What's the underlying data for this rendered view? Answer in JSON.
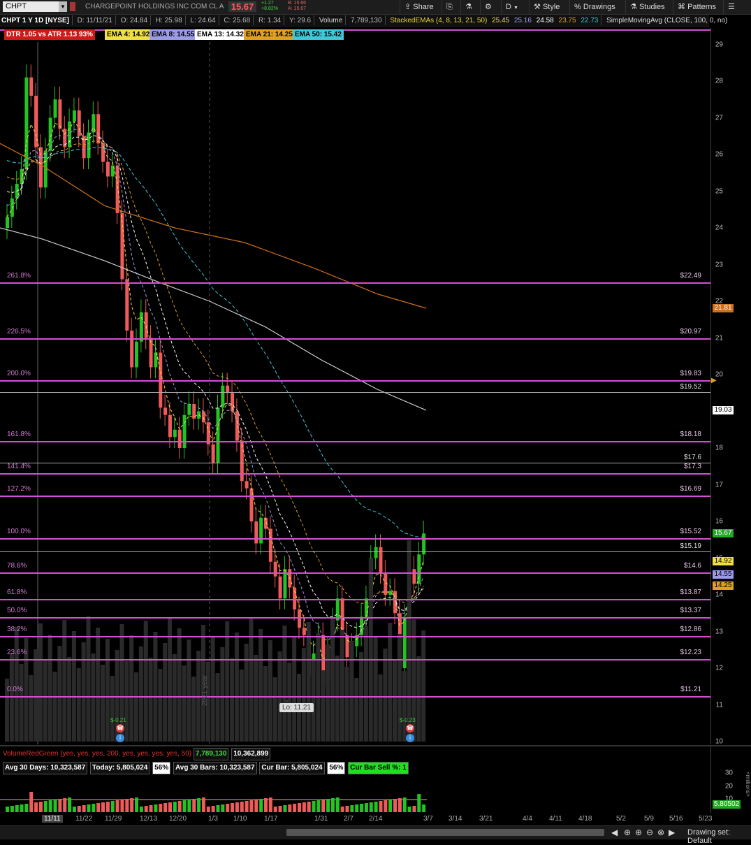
{
  "toolbar": {
    "symbol": "CHPT",
    "company": "CHARGEPOINT HOLDINGS INC COM CL A",
    "last": "15.67",
    "change": "+1.27",
    "change_pct": "+8.82%",
    "bid": "B: 15.66",
    "ask": "A: 15.67",
    "share": "Share",
    "timeframe": "D",
    "style": "Style",
    "drawings": "Drawings",
    "studies": "Studies",
    "patterns": "Patterns"
  },
  "header": {
    "title": "CHPT 1 Y 1D [NYSE]",
    "date": "D: 11/11/21",
    "open": "O: 24.84",
    "high": "H: 25.98",
    "low": "L: 24.64",
    "close": "C: 25.68",
    "range": "R: 1.34",
    "y": "Y: 29.6",
    "volume_label": "Volume",
    "volume": "7,789,130",
    "stacked_label": "StackedEMAs (4, 8, 13, 21, 50)",
    "stacked_values": [
      "25.45",
      "25.16",
      "24.58",
      "23.75",
      "22.73"
    ],
    "sma_label": "SimpleMovingAvg (CLOSE, 100, 0, no)"
  },
  "studies": {
    "dtr": "DTR 1.05 vs ATR 1.13  93%",
    "ema4": "EMA 4: 14.92",
    "ema8": "EMA 8: 14.55",
    "ema13": "EMA 13: 14.32",
    "ema21": "EMA 21: 14.25",
    "ema50": "EMA 50: 15.42"
  },
  "price_axis": {
    "ticks": [
      "29",
      "28",
      "27",
      "26",
      "25",
      "24",
      "23",
      "22",
      "21",
      "20",
      "19",
      "18",
      "17",
      "16",
      "15",
      "14",
      "13",
      "12",
      "11",
      "10"
    ],
    "tags": {
      "last": "15.67",
      "sma100": "19.03",
      "sma200": "21.81",
      "ema4": "14.92",
      "ema8": "14.55",
      "ema21": "14.25"
    }
  },
  "fib_levels": [
    {
      "pct": "261.8%",
      "price": "$22.49",
      "y": 22.49
    },
    {
      "pct": "226.5%",
      "price": "$20.97",
      "y": 20.97
    },
    {
      "pct": "200.0%",
      "price": "$19.83",
      "y": 19.83
    },
    {
      "pct": "161.8%",
      "price": "$18.18",
      "y": 18.18
    },
    {
      "pct": "141.4%",
      "price": "$17.3",
      "y": 17.3
    },
    {
      "pct": "127.2%",
      "price": "$16.69",
      "y": 16.69
    },
    {
      "pct": "100.0%",
      "price": "$15.52",
      "y": 15.52
    },
    {
      "pct": "78.6%",
      "price": "$14.6",
      "y": 14.6
    },
    {
      "pct": "61.8%",
      "price": "$13.87",
      "y": 13.87
    },
    {
      "pct": "50.0%",
      "price": "$13.37",
      "y": 13.37
    },
    {
      "pct": "38.2%",
      "price": "$12.86",
      "y": 12.86
    },
    {
      "pct": "23.6%",
      "price": "$12.23",
      "y": 12.23
    },
    {
      "pct": "0.0%",
      "price": "$11.21",
      "y": 11.21
    }
  ],
  "ref_lines": [
    {
      "price": "$19.52",
      "y": 19.52
    },
    {
      "price": "$17.6",
      "y": 17.6
    },
    {
      "price": "$15.19",
      "y": 15.19
    }
  ],
  "low_label": "Lo: 11.21",
  "year_label": "2021 year",
  "dividends": [
    "$-0.21",
    "$-0.23"
  ],
  "volume_panel": {
    "study": "VolumeRedGreen (yes, yes, yes, 200, yes, yes, yes, yes, 50)",
    "vol": "7,789,130",
    "avg": "10,362,899",
    "avg30days": "Avg 30 Days: 10,323,587",
    "today": "Today: 5,805,024",
    "pct1": "56%",
    "avg30bars": "Avg 30 Bars: 10,323,587",
    "curbar": "Cur Bar: 5,805,024",
    "pct2": "56%",
    "sell": "Cur Bar Sell %: 1",
    "ticks": [
      "30",
      "20",
      "10"
    ],
    "units": "<millions>",
    "last_tag": "5.80502"
  },
  "x_axis": [
    "11/11",
    "11/22",
    "11/29",
    "12/13",
    "12/20",
    "1/3",
    "1/10",
    "1/17",
    "1/31",
    "2/7",
    "2/14",
    "3/7",
    "3/14",
    "3/21",
    "4/4",
    "4/11",
    "4/18",
    "5/2",
    "5/9",
    "5/16",
    "5/23"
  ],
  "status": {
    "drawing_set": "Drawing set: Default"
  },
  "colors": {
    "fib": "#d44fd4",
    "up": "#22c322",
    "down": "#f05a5a",
    "ema4": "#f0e040",
    "ema8": "#9b9be8",
    "ema13": "#ffffff",
    "ema21": "#e0a020",
    "ema50": "#3ec8d8",
    "sma100": "#cccccc",
    "sma200": "#d0701a"
  }
}
